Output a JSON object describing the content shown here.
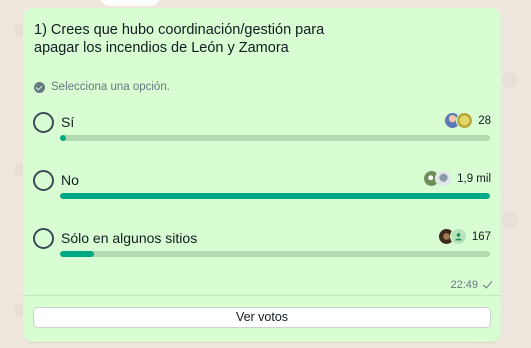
{
  "poll": {
    "question": "1) Crees que hubo coordinación/gestión para apagar los incendios de León y Zamora",
    "hint": "Selecciona una opción.",
    "options": [
      {
        "label": "Sí",
        "count": "28",
        "fraction": 0.015
      },
      {
        "label": "No",
        "count": "1,9 mil",
        "fraction": 1.0
      },
      {
        "label": "Sólo en algunos sitios",
        "count": "167",
        "fraction": 0.08
      }
    ],
    "time": "22:49",
    "votes_button": "Ver votos"
  },
  "colors": {
    "bubble": "#d9fdd3",
    "bar_fill": "#00a884",
    "bar_track": "#b3d9b0",
    "background": "#efe7dd"
  },
  "icons": {
    "hint": "check-circle-icon",
    "status": "sent-check-icon"
  }
}
